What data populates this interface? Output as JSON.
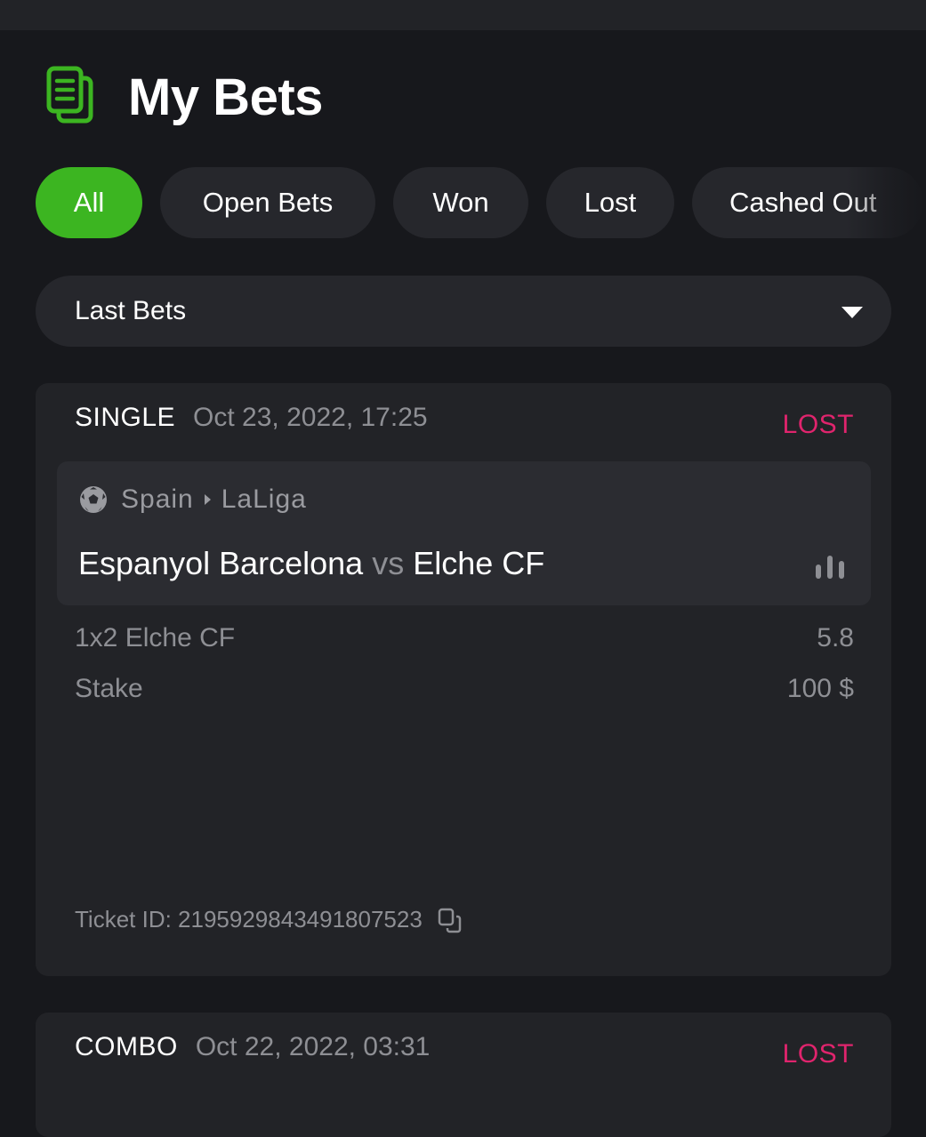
{
  "page": {
    "title": "My Bets",
    "header_icon": "bets-document-icon"
  },
  "tabs": [
    {
      "label": "All",
      "active": true
    },
    {
      "label": "Open Bets",
      "active": false
    },
    {
      "label": "Won",
      "active": false
    },
    {
      "label": "Lost",
      "active": false
    },
    {
      "label": "Cashed Out",
      "active": false
    }
  ],
  "filter": {
    "selected": "Last Bets"
  },
  "bets": [
    {
      "type": "SINGLE",
      "date": "Oct 23, 2022, 17:25",
      "status": "LOST",
      "sport_icon": "soccer-ball-icon",
      "country": "Spain",
      "league": "LaLiga",
      "home": "Espanyol Barcelona",
      "vs": "vs",
      "away": "Elche CF",
      "selection_label": "1x2 Elche CF",
      "selection_value": "5.8",
      "stake_label": "Stake",
      "stake_value": "100 $",
      "ticket_label": "Ticket ID: 2195929843491807523"
    },
    {
      "type": "COMBO",
      "date": "Oct 22, 2022, 03:31",
      "status": "LOST"
    }
  ],
  "colors": {
    "accent": "#3cb521",
    "lost": "#e0246d",
    "background": "#17181c",
    "card": "#222327"
  }
}
